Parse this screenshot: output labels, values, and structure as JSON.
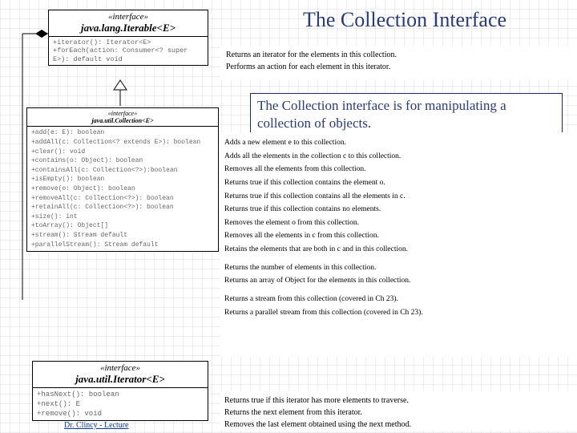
{
  "title": "The Collection Interface",
  "explain": "The Collection interface is for manipulating a collection of objects.",
  "iterable": {
    "stereo": "«interface»",
    "name": "java.lang.Iterable<E>",
    "methods": [
      "+iterator(): Iterator<E>",
      "+forEach(action: Consumer<? super E>): default void"
    ],
    "descs": [
      "Returns an iterator for the elements in this collection.",
      "Performs an action for each element in this iterator."
    ]
  },
  "collection": {
    "stereo": "«interface»",
    "name": "java.util.Collection<E>",
    "methods": [
      "+add(e: E): boolean",
      "+addAll(c: Collection<? extends E>): boolean",
      "+clear(): void",
      "+contains(o: Object): boolean",
      "+containsAll(c: Collection<?>):boolean",
      "+isEmpty(): boolean",
      "+remove(o: Object): boolean",
      "+removeAll(c: Collection<?>): boolean",
      "+retainAll(c: Collection<?>): boolean",
      "+size(): int",
      "+toArray(): Object[]",
      "+stream(): Stream default",
      "+parallelStream(): Stream default"
    ],
    "descs": [
      "Adds a new element e to this collection.",
      "Adds all the elements in the collection c to this collection.",
      "Removes all the elements from this collection.",
      "Returns true if this collection contains the element o.",
      "Returns true if this collection contains all the elements in c.",
      "Returns true if this collection contains no elements.",
      "Removes the element o from this collection.",
      "Removes all the elements in c from this collection.",
      "Retains the elements that are both in c and in this collection.",
      "Returns the number of elements in this collection.",
      "Returns an array of Object for the elements in this collection.",
      "Returns a stream from this collection (covered in Ch 23).",
      "Returns a parallel stream from this collection (covered in Ch 23)."
    ]
  },
  "iterator": {
    "stereo": "«interface»",
    "name": "java.util.Iterator<E>",
    "methods": [
      "+hasNext(): boolean",
      "+next(): E",
      "+remove(): void"
    ],
    "descs": [
      "Returns true if this iterator has more elements to traverse.",
      "Returns the next element from this iterator.",
      "Removes the last element obtained using the next method."
    ]
  },
  "footer": "Dr. Clincy - Lecture"
}
